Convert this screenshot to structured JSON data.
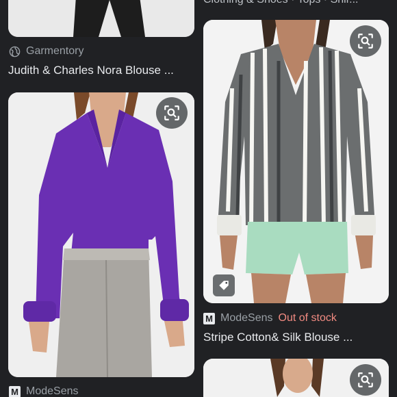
{
  "left_column": {
    "top_card": {
      "source": "Garmentory",
      "title": "Judith & Charles Nora Blouse ..."
    },
    "middle_card": {
      "source": "ModeSens"
    }
  },
  "right_column": {
    "top_crumb": "Clothing & Shoes · Tops · Shir...",
    "middle_card": {
      "source": "ModeSens",
      "status": "Out of stock",
      "title": "Stripe Cotton& Silk Blouse ..."
    }
  },
  "icons": {
    "globe": "globe-icon",
    "lens": "lens-search-icon",
    "tag": "price-tag-icon",
    "modesens": "modesens-logo-icon"
  },
  "colors": {
    "background": "#202124",
    "out_of_stock": "#f28b82",
    "purple_blouse": "#6a2fb3"
  }
}
